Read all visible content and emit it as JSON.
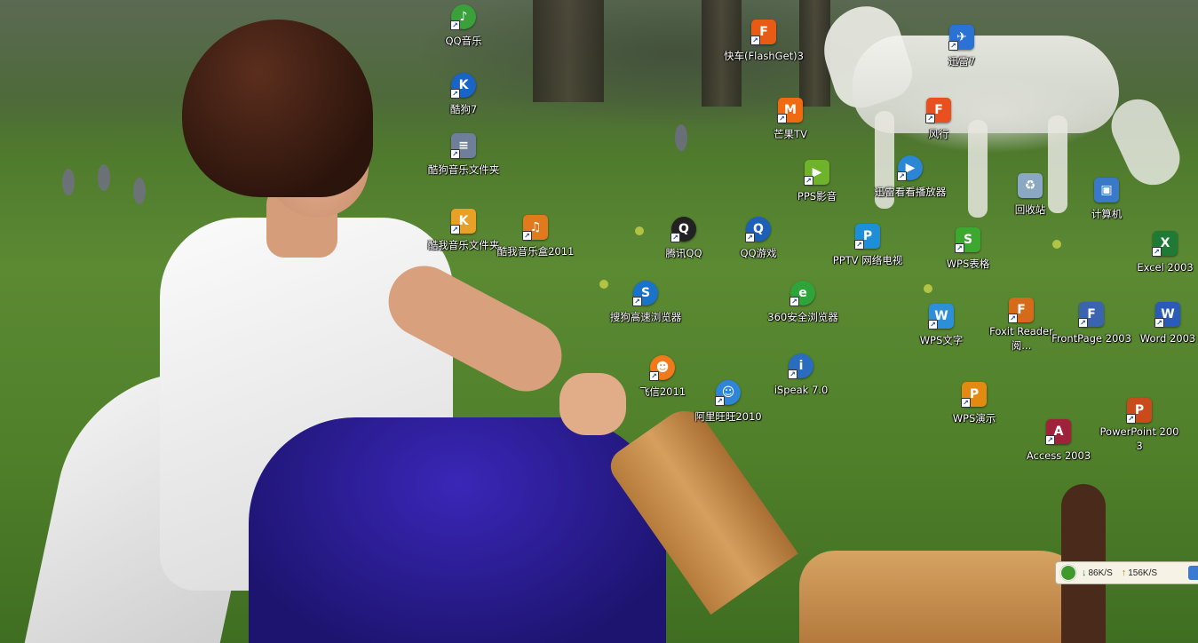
{
  "wallpaper": {
    "description_colors": {
      "grass": "#5b8a33",
      "shirt": "#f4f4f4",
      "pants": "#2a1e9a",
      "boots": "#c98f4e"
    }
  },
  "desktop_icons": [
    {
      "label": "QQ音乐",
      "icon": "qq-music-icon",
      "glyph": "♪",
      "color": "#3aa13a",
      "round": true
    },
    {
      "label": "酷狗7",
      "icon": "kugou-icon",
      "glyph": "K",
      "color": "#1a63c7",
      "round": true
    },
    {
      "label": "酷狗音乐文件夹",
      "icon": "folder-file-icon",
      "glyph": "≡",
      "color": "#6f7f99",
      "round": false
    },
    {
      "label": "酷我音乐文件夹",
      "icon": "kuwo-folder-icon",
      "glyph": "K",
      "color": "#e8a126",
      "round": false
    },
    {
      "label": "酷我音乐盒2011",
      "icon": "kuwo-box-icon",
      "glyph": "♫",
      "color": "#e07a1d",
      "round": false
    },
    {
      "label": "快车(FlashGet)3",
      "icon": "flashget-icon",
      "glyph": "F",
      "color": "#e85b14",
      "round": false
    },
    {
      "label": "芒果TV",
      "icon": "mangotv-icon",
      "glyph": "M",
      "color": "#f06a12",
      "round": false
    },
    {
      "label": "PPS影音",
      "icon": "pps-icon",
      "glyph": "▶",
      "color": "#6fb22b",
      "round": false
    },
    {
      "label": "迅雷7",
      "icon": "thunder-icon",
      "glyph": "✈",
      "color": "#2a72d4",
      "round": false
    },
    {
      "label": "风行",
      "icon": "funshion-icon",
      "glyph": "F",
      "color": "#e8501f",
      "round": false
    },
    {
      "label": "迅雷看看播放器",
      "icon": "xunlei-kankan-icon",
      "glyph": "▶",
      "color": "#2b86d6",
      "round": true
    },
    {
      "label": "回收站",
      "icon": "recycle-bin-icon",
      "glyph": "♻",
      "color": "#8aa7c4",
      "round": false
    },
    {
      "label": "计算机",
      "icon": "computer-icon",
      "glyph": "▣",
      "color": "#3a78c8",
      "round": false
    },
    {
      "label": "腾讯QQ",
      "icon": "qq-penguin-icon",
      "glyph": "Q",
      "color": "#222222",
      "round": true
    },
    {
      "label": "QQ游戏",
      "icon": "qq-game-icon",
      "glyph": "Q",
      "color": "#1e5fb8",
      "round": true
    },
    {
      "label": "PPTV 网络电视",
      "icon": "pptv-icon",
      "glyph": "P",
      "color": "#1d8fd8",
      "round": false
    },
    {
      "label": "WPS表格",
      "icon": "wps-sheet-icon",
      "glyph": "S",
      "color": "#3da82f",
      "round": false
    },
    {
      "label": "Excel 2003",
      "icon": "excel-icon",
      "glyph": "X",
      "color": "#1f7a35",
      "round": false
    },
    {
      "label": "搜狗高速浏览器",
      "icon": "sogou-browser-icon",
      "glyph": "S",
      "color": "#1a73c9",
      "round": true
    },
    {
      "label": "360安全浏览器",
      "icon": "360-browser-icon",
      "glyph": "e",
      "color": "#2fa43b",
      "round": true
    },
    {
      "label": "WPS文字",
      "icon": "wps-writer-icon",
      "glyph": "W",
      "color": "#2d8fd7",
      "round": false
    },
    {
      "label": "Foxit Reader 阅...",
      "icon": "foxit-icon",
      "glyph": "F",
      "color": "#d46a1a",
      "round": false
    },
    {
      "label": "FrontPage 2003",
      "icon": "frontpage-icon",
      "glyph": "F",
      "color": "#3b64b0",
      "round": false
    },
    {
      "label": "Word 2003",
      "icon": "word-icon",
      "glyph": "W",
      "color": "#2b5bb8",
      "round": false
    },
    {
      "label": "飞信2011",
      "icon": "fetion-icon",
      "glyph": "☻",
      "color": "#f07a1a",
      "round": true
    },
    {
      "label": "阿里旺旺2010",
      "icon": "aliwangwang-icon",
      "glyph": "☺",
      "color": "#2f86d8",
      "round": true
    },
    {
      "label": "iSpeak 7.0",
      "icon": "ispeak-icon",
      "glyph": "i",
      "color": "#2a6cc0",
      "round": true
    },
    {
      "label": "WPS演示",
      "icon": "wps-presentation-icon",
      "glyph": "P",
      "color": "#e28a12",
      "round": false
    },
    {
      "label": "Access 2003",
      "icon": "access-icon",
      "glyph": "A",
      "color": "#a0223a",
      "round": false
    },
    {
      "label": "PowerPoint 2003",
      "icon": "powerpoint-icon",
      "glyph": "P",
      "color": "#c94a1a",
      "round": false
    }
  ],
  "speed_widget": {
    "download": "86K/S",
    "upload": "156K/S"
  }
}
